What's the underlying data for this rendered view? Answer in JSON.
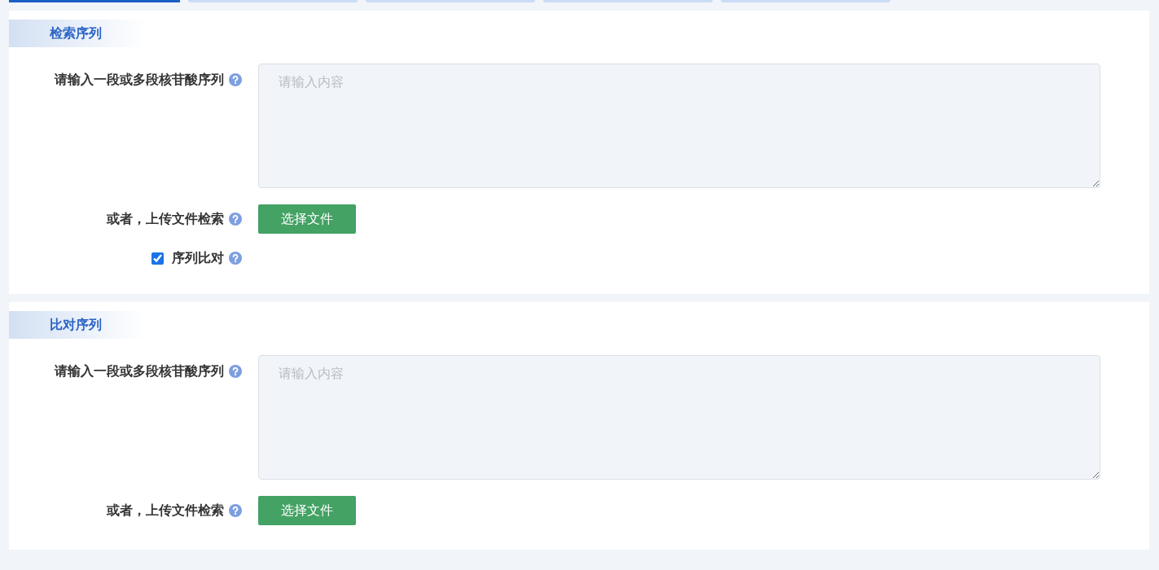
{
  "tabs": [
    {
      "selected": true
    },
    {
      "selected": false
    },
    {
      "selected": false
    },
    {
      "selected": false
    },
    {
      "selected": false
    }
  ],
  "sections": [
    {
      "title": "检索序列",
      "rows": [
        {
          "kind": "textarea",
          "label": "请输入一段或多段核苷酸序列",
          "placeholder": "请输入内容"
        },
        {
          "kind": "file",
          "label": "或者，上传文件检索",
          "button": "选择文件"
        },
        {
          "kind": "checkbox",
          "label": "序列比对",
          "checked": true
        }
      ]
    },
    {
      "title": "比对序列",
      "rows": [
        {
          "kind": "textarea",
          "label": "请输入一段或多段核苷酸序列",
          "placeholder": "请输入内容"
        },
        {
          "kind": "file",
          "label": "或者，上传文件检索",
          "button": "选择文件"
        }
      ]
    }
  ]
}
